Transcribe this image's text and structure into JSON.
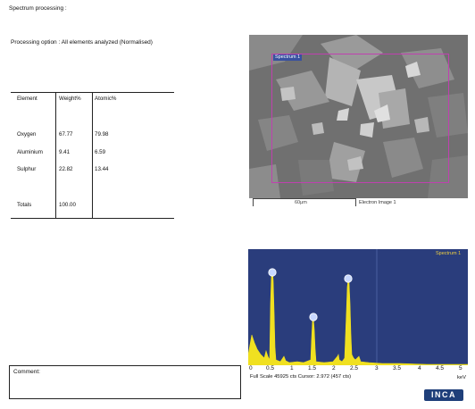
{
  "header": {
    "title": "Spectrum processing :",
    "processing_option": "Processing option : All elements analyzed (Normalised)"
  },
  "results_table": {
    "columns": [
      "Element",
      "Weight%",
      "Atomic%"
    ],
    "rows": [
      {
        "element": "Oxygen",
        "weight": "67.77",
        "atomic": "79.98"
      },
      {
        "element": "Aluminium",
        "weight": "9.41",
        "atomic": "6.59"
      },
      {
        "element": "Sulphur",
        "weight": "22.82",
        "atomic": "13.44"
      }
    ],
    "totals_label": "Totals",
    "totals_weight": "100.00"
  },
  "electron_image": {
    "roi_label": "Spectrum 1",
    "scale_bar_label": "60μm",
    "caption": "Electron Image 1"
  },
  "spectrum": {
    "title": "Spectrum 1",
    "x_ticks": [
      "0",
      "0.5",
      "1",
      "1.5",
      "2",
      "2.5",
      "3",
      "3.5",
      "4",
      "4.5",
      "5"
    ],
    "x_unit": "keV",
    "footer": "Full Scale 45925 cts Cursor: 2.972  (457 cts)",
    "colors": {
      "background": "#2a3d7c",
      "trace": "#f0e020"
    }
  },
  "comment": {
    "label": "Comment:"
  },
  "logo_text": "INCA"
}
